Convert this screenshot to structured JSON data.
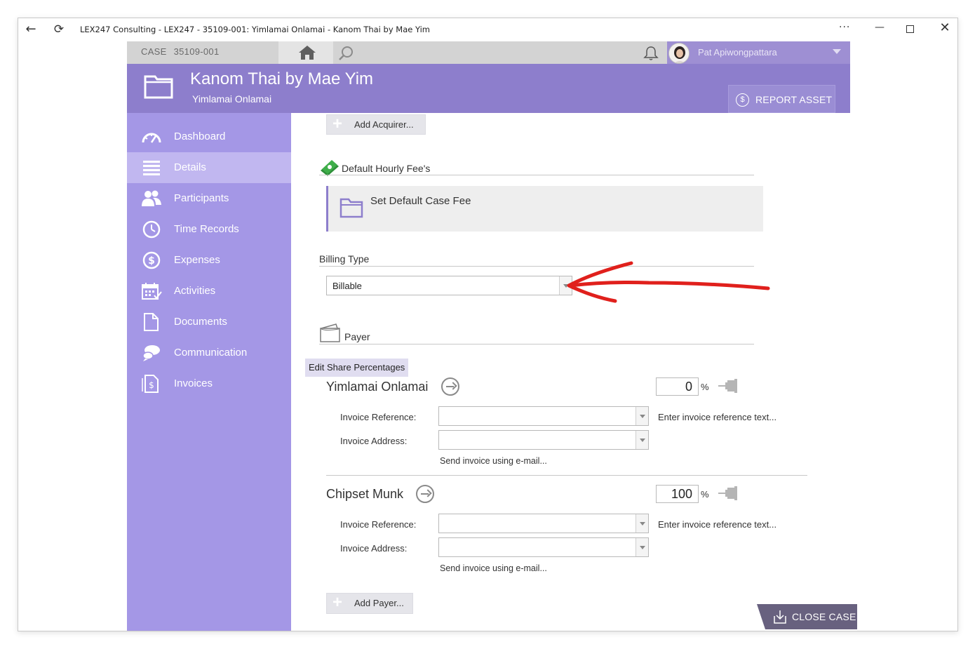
{
  "window": {
    "title": "LEX247 Consulting - LEX247 - 35109-001: Yimlamai Onlamai - Kanom Thai by Mae Yim",
    "more_label": "···"
  },
  "topbar": {
    "case_label": "CASE",
    "case_number": "35109-001",
    "user_name": "Pat Apiwongpattara"
  },
  "header": {
    "title": "Kanom Thai by Mae Yim",
    "subtitle": "Yimlamai Onlamai",
    "report_button": "REPORT ASSET"
  },
  "sidebar": {
    "items": [
      {
        "label": "Dashboard",
        "icon": "gauge-icon"
      },
      {
        "label": "Details",
        "icon": "list-icon",
        "active": true
      },
      {
        "label": "Participants",
        "icon": "people-icon"
      },
      {
        "label": "Time Records",
        "icon": "clock-icon"
      },
      {
        "label": "Expenses",
        "icon": "dollar-icon"
      },
      {
        "label": "Activities",
        "icon": "calendar-icon"
      },
      {
        "label": "Documents",
        "icon": "document-icon"
      },
      {
        "label": "Communication",
        "icon": "chat-icon"
      },
      {
        "label": "Invoices",
        "icon": "invoice-icon"
      }
    ]
  },
  "content": {
    "add_acquirer": "Add Acquirer...",
    "fees_section": "Default Hourly Fee's",
    "set_default_fee": "Set Default Case Fee",
    "billing_section": "Billing Type",
    "billing_value": "Billable",
    "payer_section": "Payer",
    "edit_share": "Edit Share Percentages",
    "payers": [
      {
        "name": "Yimlamai Onlamai",
        "percent": "0",
        "invoice_reference_label": "Invoice Reference:",
        "invoice_address_label": "Invoice Address:",
        "reference_hint": "Enter invoice reference text...",
        "email_link": "Send invoice using e-mail..."
      },
      {
        "name": "Chipset Munk",
        "percent": "100",
        "invoice_reference_label": "Invoice Reference:",
        "invoice_address_label": "Invoice Address:",
        "reference_hint": "Enter invoice reference text...",
        "email_link": "Send invoice using e-mail..."
      }
    ],
    "percent_sign": "%",
    "add_payer": "Add Payer...",
    "close_case": "CLOSE CASE"
  },
  "colors": {
    "header": "#8d7ecc",
    "sidebar": "#a497e6",
    "sidebar_active": "#c1b7f0",
    "annotation_arrow": "#e0201c"
  }
}
